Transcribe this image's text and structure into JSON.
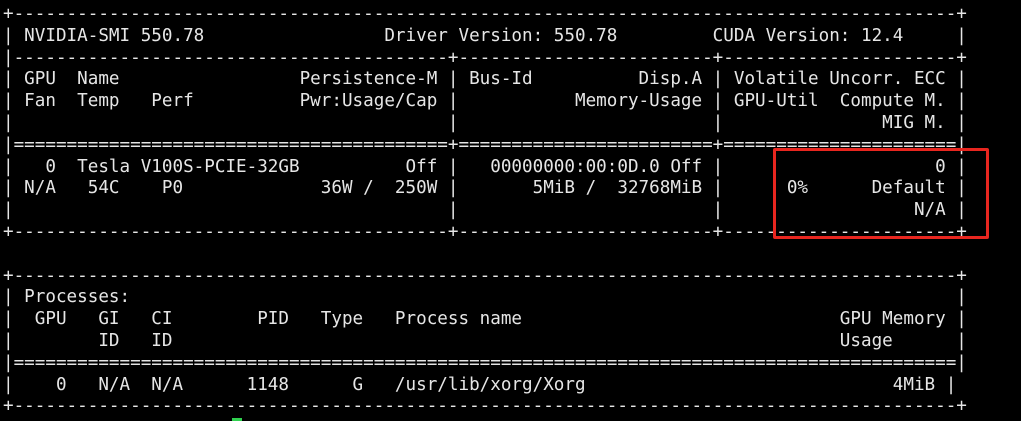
{
  "terminal": {
    "lines": [
      "+-----------------------------------------------------------------------------------------+",
      "| NVIDIA-SMI 550.78                 Driver Version: 550.78         CUDA Version: 12.4     |",
      "|-----------------------------------------+------------------------+----------------------+",
      "| GPU  Name                 Persistence-M | Bus-Id          Disp.A | Volatile Uncorr. ECC |",
      "| Fan  Temp   Perf          Pwr:Usage/Cap |           Memory-Usage | GPU-Util  Compute M. |",
      "|                                         |                        |               MIG M. |",
      "|=========================================+========================+======================|",
      "|   0  Tesla V100S-PCIE-32GB          Off |   00000000:00:0D.0 Off |                    0 |",
      "| N/A   54C    P0             36W /  250W |       5MiB /  32768MiB |      0%      Default |",
      "|                                         |                        |                  N/A |",
      "+-----------------------------------------+------------------------+----------------------+",
      "",
      "+-----------------------------------------------------------------------------------------+",
      "| Processes:                                                                              |",
      "|  GPU   GI   CI        PID   Type   Process name                              GPU Memory |",
      "|        ID   ID                                                               Usage      |",
      "|=========================================================================================|",
      "|    0   N/A  N/A      1148      G   /usr/lib/xorg/Xorg                             4MiB |",
      "+-----------------------------------------------------------------------------------------+"
    ]
  },
  "highlight_color": "#e8261f",
  "cursor_color": "#2fd14f"
}
